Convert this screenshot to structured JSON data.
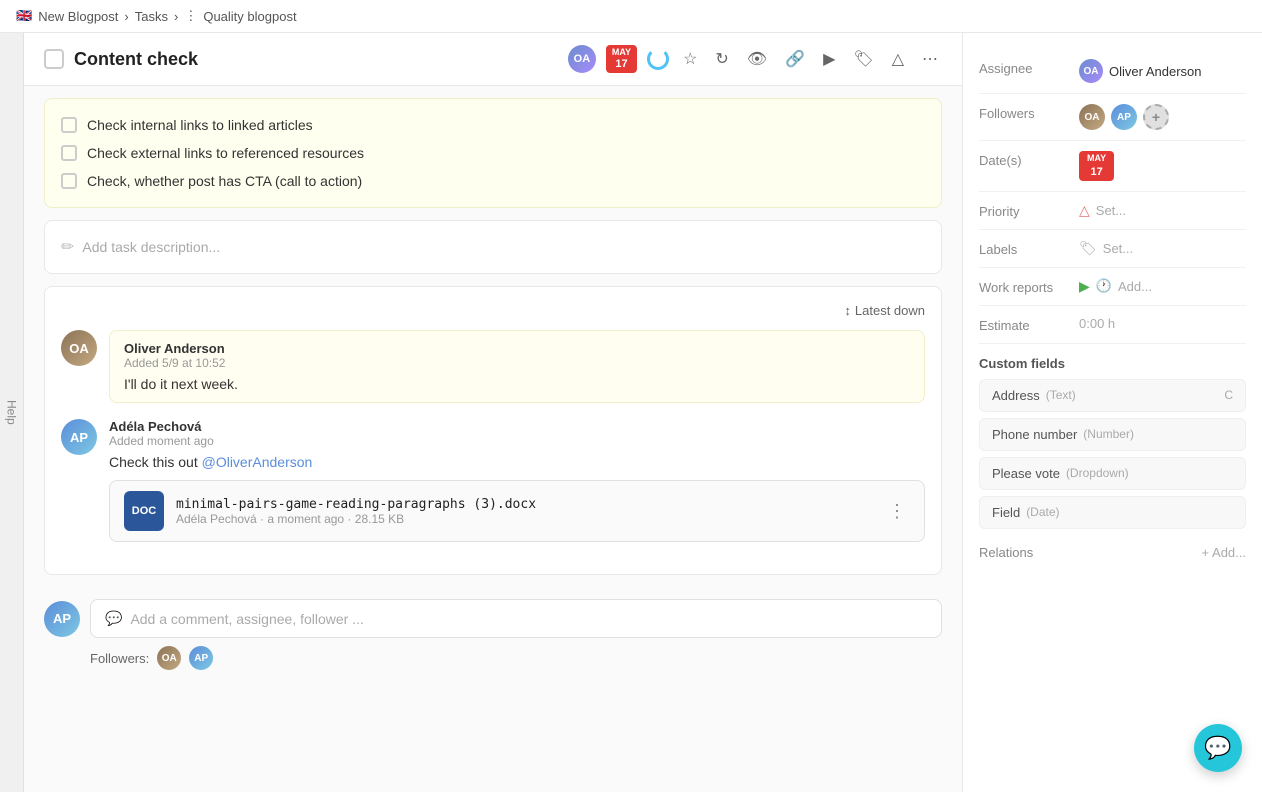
{
  "breadcrumb": {
    "flag": "🇬🇧",
    "project": "New Blogpost",
    "sep1": "›",
    "section": "Tasks",
    "sep2": "›",
    "dots": "⋮",
    "page": "Quality blogpost"
  },
  "header": {
    "title": "Content check",
    "avatar_initials": "OA",
    "date_month": "May",
    "date_day": "17",
    "actions": {
      "play": "▶",
      "tag": "🏷",
      "alert": "△",
      "more": "⋯"
    }
  },
  "checklist": {
    "items": [
      "Check internal links to linked articles",
      "Check external links to referenced resources",
      "Check, whether post has CTA (call to action)"
    ]
  },
  "description": {
    "placeholder": "Add task description..."
  },
  "comments": {
    "sort_label": "Latest down",
    "items": [
      {
        "author": "Oliver Anderson",
        "time": "Added 5/9 at 10:52",
        "text": "I'll do it next week.",
        "initials": "OA",
        "type": "oliver"
      },
      {
        "author": "Adéla Pechová",
        "time": "Added moment ago",
        "text": "Check this out ",
        "mention": "@OliverAnderson",
        "initials": "AP",
        "type": "adela",
        "file": {
          "name": "minimal-pairs-game-reading-paragraphs (3).docx",
          "author": "Adéla Pechová",
          "time": "a moment ago",
          "size": "28.15 KB",
          "ext": "DOC"
        }
      }
    ]
  },
  "add_comment": {
    "placeholder": "Add a comment, assignee, follower ...",
    "followers_label": "Followers:"
  },
  "sidebar": {
    "assignee_label": "Assignee",
    "assignee_name": "Oliver Anderson",
    "assignee_initials": "OA",
    "followers_label": "Followers",
    "date_label": "Date(s)",
    "date_month": "May",
    "date_day": "17",
    "priority_label": "Priority",
    "priority_placeholder": "Set...",
    "labels_label": "Labels",
    "labels_placeholder": "Set...",
    "work_reports_label": "Work reports",
    "work_reports_add": "Add...",
    "estimate_label": "Estimate",
    "estimate_value": "0:00 h",
    "custom_fields_header": "Custom fields",
    "custom_fields": [
      {
        "name": "Address",
        "type": "Text",
        "shortcut": "C"
      },
      {
        "name": "Phone number",
        "type": "Number",
        "shortcut": ""
      },
      {
        "name": "Please vote",
        "type": "Dropdown",
        "shortcut": ""
      },
      {
        "name": "Field",
        "type": "Date",
        "shortcut": ""
      }
    ],
    "relations_label": "Relations",
    "relations_add": "+ Add..."
  },
  "help_label": "Help",
  "icons": {
    "star": "☆",
    "refresh": "↻",
    "eye": "👁",
    "link": "🔗",
    "pencil": "✏",
    "comment_bubble": "💬",
    "up_arrow": "↑",
    "down_arrow": "↓",
    "play": "▶",
    "clock": "🕐",
    "plus": "+"
  },
  "fab_icon": "💬"
}
